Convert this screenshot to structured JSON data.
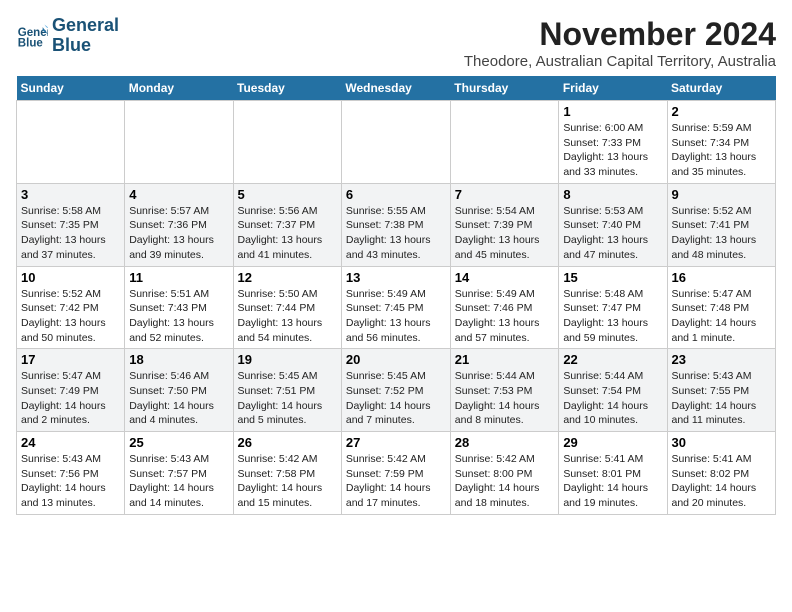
{
  "logo": {
    "line1": "General",
    "line2": "Blue"
  },
  "title": "November 2024",
  "location": "Theodore, Australian Capital Territory, Australia",
  "weekdays": [
    "Sunday",
    "Monday",
    "Tuesday",
    "Wednesday",
    "Thursday",
    "Friday",
    "Saturday"
  ],
  "weeks": [
    [
      {
        "day": "",
        "info": ""
      },
      {
        "day": "",
        "info": ""
      },
      {
        "day": "",
        "info": ""
      },
      {
        "day": "",
        "info": ""
      },
      {
        "day": "",
        "info": ""
      },
      {
        "day": "1",
        "info": "Sunrise: 6:00 AM\nSunset: 7:33 PM\nDaylight: 13 hours\nand 33 minutes."
      },
      {
        "day": "2",
        "info": "Sunrise: 5:59 AM\nSunset: 7:34 PM\nDaylight: 13 hours\nand 35 minutes."
      }
    ],
    [
      {
        "day": "3",
        "info": "Sunrise: 5:58 AM\nSunset: 7:35 PM\nDaylight: 13 hours\nand 37 minutes."
      },
      {
        "day": "4",
        "info": "Sunrise: 5:57 AM\nSunset: 7:36 PM\nDaylight: 13 hours\nand 39 minutes."
      },
      {
        "day": "5",
        "info": "Sunrise: 5:56 AM\nSunset: 7:37 PM\nDaylight: 13 hours\nand 41 minutes."
      },
      {
        "day": "6",
        "info": "Sunrise: 5:55 AM\nSunset: 7:38 PM\nDaylight: 13 hours\nand 43 minutes."
      },
      {
        "day": "7",
        "info": "Sunrise: 5:54 AM\nSunset: 7:39 PM\nDaylight: 13 hours\nand 45 minutes."
      },
      {
        "day": "8",
        "info": "Sunrise: 5:53 AM\nSunset: 7:40 PM\nDaylight: 13 hours\nand 47 minutes."
      },
      {
        "day": "9",
        "info": "Sunrise: 5:52 AM\nSunset: 7:41 PM\nDaylight: 13 hours\nand 48 minutes."
      }
    ],
    [
      {
        "day": "10",
        "info": "Sunrise: 5:52 AM\nSunset: 7:42 PM\nDaylight: 13 hours\nand 50 minutes."
      },
      {
        "day": "11",
        "info": "Sunrise: 5:51 AM\nSunset: 7:43 PM\nDaylight: 13 hours\nand 52 minutes."
      },
      {
        "day": "12",
        "info": "Sunrise: 5:50 AM\nSunset: 7:44 PM\nDaylight: 13 hours\nand 54 minutes."
      },
      {
        "day": "13",
        "info": "Sunrise: 5:49 AM\nSunset: 7:45 PM\nDaylight: 13 hours\nand 56 minutes."
      },
      {
        "day": "14",
        "info": "Sunrise: 5:49 AM\nSunset: 7:46 PM\nDaylight: 13 hours\nand 57 minutes."
      },
      {
        "day": "15",
        "info": "Sunrise: 5:48 AM\nSunset: 7:47 PM\nDaylight: 13 hours\nand 59 minutes."
      },
      {
        "day": "16",
        "info": "Sunrise: 5:47 AM\nSunset: 7:48 PM\nDaylight: 14 hours\nand 1 minute."
      }
    ],
    [
      {
        "day": "17",
        "info": "Sunrise: 5:47 AM\nSunset: 7:49 PM\nDaylight: 14 hours\nand 2 minutes."
      },
      {
        "day": "18",
        "info": "Sunrise: 5:46 AM\nSunset: 7:50 PM\nDaylight: 14 hours\nand 4 minutes."
      },
      {
        "day": "19",
        "info": "Sunrise: 5:45 AM\nSunset: 7:51 PM\nDaylight: 14 hours\nand 5 minutes."
      },
      {
        "day": "20",
        "info": "Sunrise: 5:45 AM\nSunset: 7:52 PM\nDaylight: 14 hours\nand 7 minutes."
      },
      {
        "day": "21",
        "info": "Sunrise: 5:44 AM\nSunset: 7:53 PM\nDaylight: 14 hours\nand 8 minutes."
      },
      {
        "day": "22",
        "info": "Sunrise: 5:44 AM\nSunset: 7:54 PM\nDaylight: 14 hours\nand 10 minutes."
      },
      {
        "day": "23",
        "info": "Sunrise: 5:43 AM\nSunset: 7:55 PM\nDaylight: 14 hours\nand 11 minutes."
      }
    ],
    [
      {
        "day": "24",
        "info": "Sunrise: 5:43 AM\nSunset: 7:56 PM\nDaylight: 14 hours\nand 13 minutes."
      },
      {
        "day": "25",
        "info": "Sunrise: 5:43 AM\nSunset: 7:57 PM\nDaylight: 14 hours\nand 14 minutes."
      },
      {
        "day": "26",
        "info": "Sunrise: 5:42 AM\nSunset: 7:58 PM\nDaylight: 14 hours\nand 15 minutes."
      },
      {
        "day": "27",
        "info": "Sunrise: 5:42 AM\nSunset: 7:59 PM\nDaylight: 14 hours\nand 17 minutes."
      },
      {
        "day": "28",
        "info": "Sunrise: 5:42 AM\nSunset: 8:00 PM\nDaylight: 14 hours\nand 18 minutes."
      },
      {
        "day": "29",
        "info": "Sunrise: 5:41 AM\nSunset: 8:01 PM\nDaylight: 14 hours\nand 19 minutes."
      },
      {
        "day": "30",
        "info": "Sunrise: 5:41 AM\nSunset: 8:02 PM\nDaylight: 14 hours\nand 20 minutes."
      }
    ]
  ]
}
